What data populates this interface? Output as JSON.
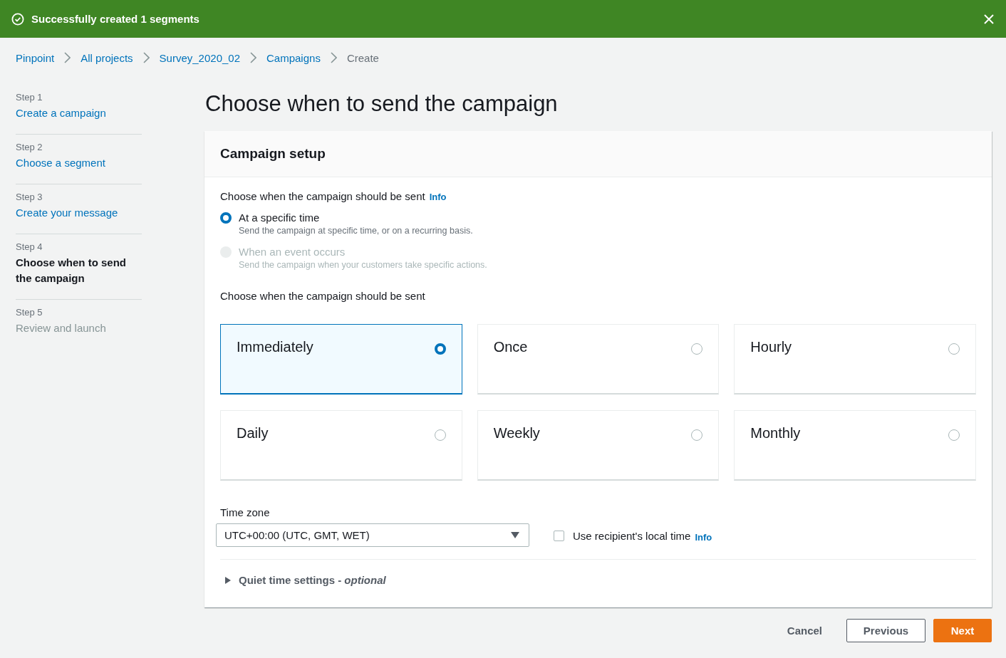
{
  "flash": {
    "message": "Successfully created 1 segments"
  },
  "breadcrumbs": [
    {
      "label": "Pinpoint",
      "current": false
    },
    {
      "label": "All projects",
      "current": false
    },
    {
      "label": "Survey_2020_02",
      "current": false
    },
    {
      "label": "Campaigns",
      "current": false
    },
    {
      "label": "Create",
      "current": true
    }
  ],
  "steps": [
    {
      "step": "Step 1",
      "title": "Create a campaign",
      "selected": false,
      "disabled": false
    },
    {
      "step": "Step 2",
      "title": "Choose a segment",
      "selected": false,
      "disabled": false
    },
    {
      "step": "Step 3",
      "title": "Create your message",
      "selected": false,
      "disabled": false
    },
    {
      "step": "Step 4",
      "title": "Choose when to send the campaign",
      "selected": true,
      "disabled": false
    },
    {
      "step": "Step 5",
      "title": "Review and launch",
      "selected": false,
      "disabled": true
    }
  ],
  "heading": "Choose when to send the campaign",
  "panel": {
    "title": "Campaign setup",
    "trigger_label": "Choose when the campaign should be sent",
    "trigger_info": "Info",
    "trigger_options": [
      {
        "label": "At a specific time",
        "description": "Send the campaign at specific time, or on a recurring basis.",
        "selected": true,
        "disabled": false
      },
      {
        "label": "When an event occurs",
        "description": "Send the campaign when your customers take specific actions.",
        "selected": false,
        "disabled": true
      }
    ],
    "frequency_label": "Choose when the campaign should be sent",
    "frequencies": [
      {
        "label": "Immediately",
        "selected": true
      },
      {
        "label": "Once",
        "selected": false
      },
      {
        "label": "Hourly",
        "selected": false
      },
      {
        "label": "Daily",
        "selected": false
      },
      {
        "label": "Weekly",
        "selected": false
      },
      {
        "label": "Monthly",
        "selected": false
      }
    ],
    "timezone": {
      "label": "Time zone",
      "value": "UTC+00:00 (UTC, GMT, WET)"
    },
    "local_time": {
      "label": "Use recipient's local time",
      "checked": false,
      "info": "Info"
    },
    "quiet_time": {
      "label": "Quiet time settings - *optional*",
      "expanded": false
    }
  },
  "buttons": [
    {
      "label": "Cancel",
      "kind": "link"
    },
    {
      "label": "Previous",
      "kind": "secondary"
    },
    {
      "label": "Next",
      "kind": "primary"
    }
  ]
}
